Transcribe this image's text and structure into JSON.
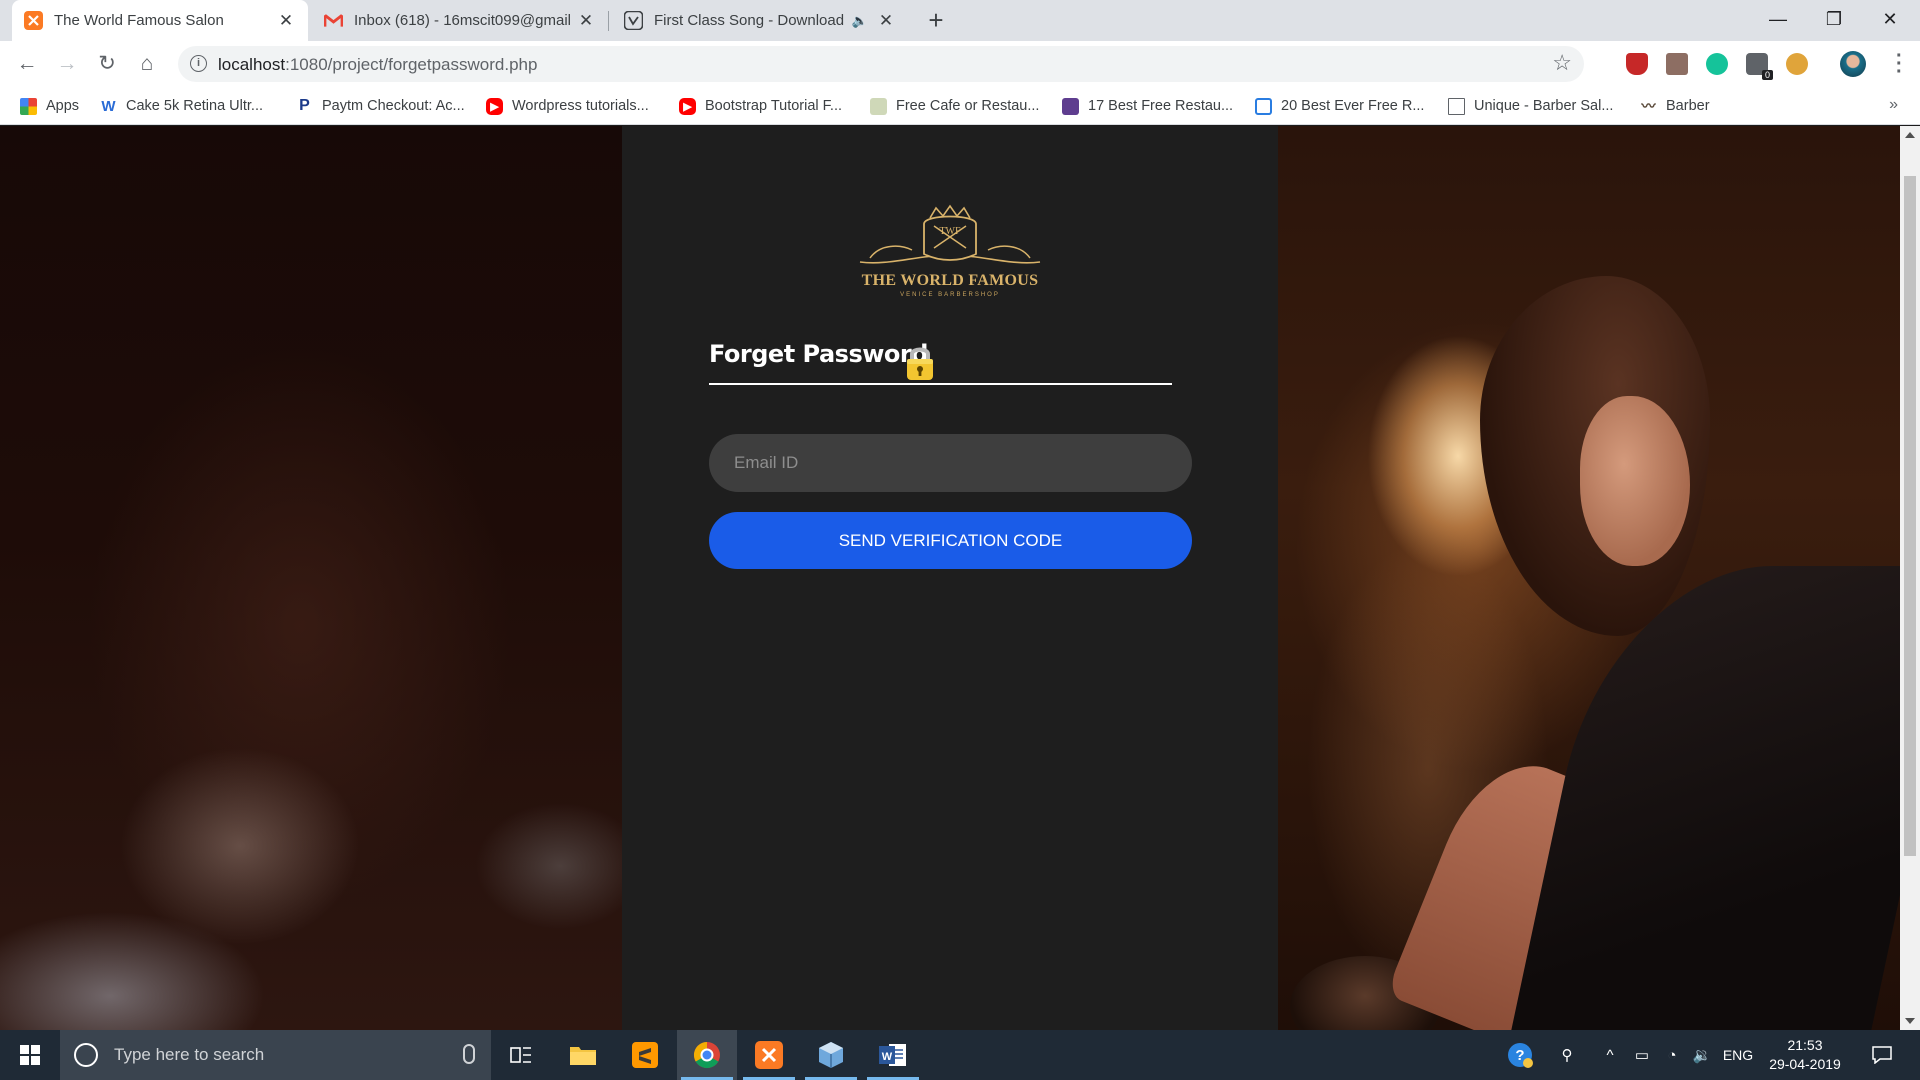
{
  "browser": {
    "tabs": [
      {
        "title": "The World Famous Salon",
        "active": true,
        "icon": "xampp-icon"
      },
      {
        "title": "Inbox (618) - 16mscit099@gmail",
        "active": false,
        "icon": "gmail-icon"
      },
      {
        "title": "First Class Song - Download",
        "active": false,
        "icon": "vk-icon",
        "audio": true
      }
    ],
    "url_host": "localhost",
    "url_rest": ":1080/project/forgetpassword.php",
    "bookmarks": [
      {
        "label": "Apps",
        "icon": "apps-grid-icon"
      },
      {
        "label": "Cake 5k Retina Ultr...",
        "icon": "w-logo-icon"
      },
      {
        "label": "Paytm Checkout: Ac...",
        "icon": "paypal-icon"
      },
      {
        "label": "Wordpress tutorials...",
        "icon": "youtube-icon"
      },
      {
        "label": "Bootstrap Tutorial F...",
        "icon": "youtube-icon"
      },
      {
        "label": "Free Cafe or Restau...",
        "icon": "page-thumb-icon"
      },
      {
        "label": "17 Best Free Restau...",
        "icon": "colorlib-icon"
      },
      {
        "label": "20 Best Ever Free R...",
        "icon": "bracket-icon"
      },
      {
        "label": "Unique - Barber Sal...",
        "icon": "document-icon"
      },
      {
        "label": "Barber",
        "icon": "mustache-icon"
      }
    ]
  },
  "page": {
    "logo": {
      "monogram": "TWF",
      "brand": "THE WORLD FAMOUS",
      "sub": "VENICE BARBERSHOP"
    },
    "title": "Forget Password",
    "email_placeholder": "Email ID",
    "email_value": "",
    "send_label": "SEND VERIFICATION CODE",
    "colors": {
      "panel": "#1e1e1e",
      "button": "#1a5ce8",
      "input": "#3e3e3e",
      "gold": "#d9b36a"
    }
  },
  "taskbar": {
    "search_placeholder": "Type here to search",
    "language": "ENG",
    "time": "21:53",
    "date": "29-04-2019",
    "ext_badge": "0"
  }
}
